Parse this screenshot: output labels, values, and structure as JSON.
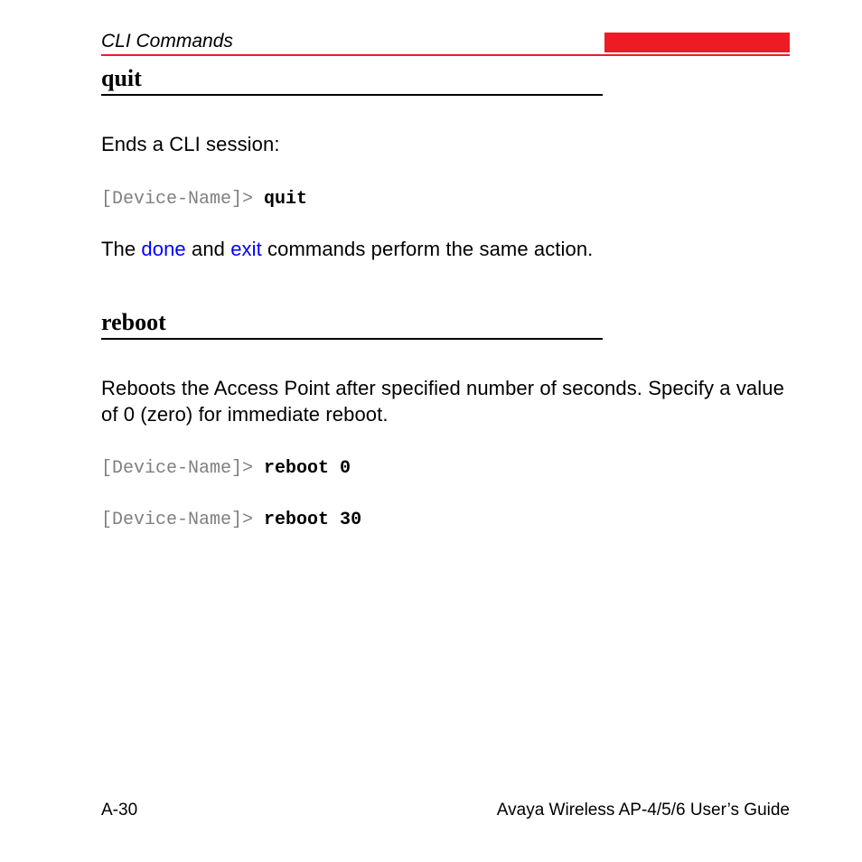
{
  "header": {
    "section": "CLI Commands"
  },
  "sections": {
    "quit": {
      "heading": "quit",
      "desc": "Ends a CLI session:",
      "code_prompt": "[Device-Name]>",
      "code_cmd": "quit",
      "after_pre": "The ",
      "link1": "done",
      "mid": " and ",
      "link2": "exit",
      "after_post": " commands perform the same action."
    },
    "reboot": {
      "heading": "reboot",
      "desc": "Reboots the Access Point after specified number of seconds. Specify a value of 0 (zero) for immediate reboot.",
      "code1_prompt": "[Device-Name]>",
      "code1_cmd": "reboot 0",
      "code2_prompt": "[Device-Name]>",
      "code2_cmd": "reboot 30"
    }
  },
  "footer": {
    "page": "A-30",
    "book": "Avaya Wireless AP-4/5/6 User’s Guide"
  }
}
